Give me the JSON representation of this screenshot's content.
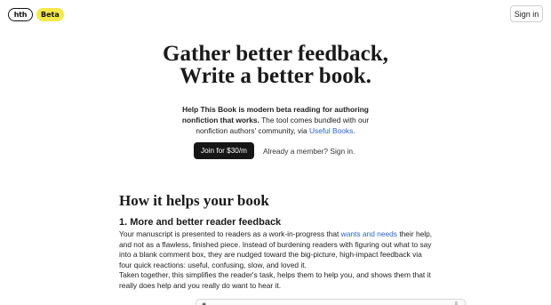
{
  "header": {
    "logo_text": "hth",
    "beta_label": "Beta",
    "signin_label": "Sign in"
  },
  "hero": {
    "title_line1": "Gather better feedback,",
    "title_line2": "Write a better book.",
    "intro_bold": "Help This Book is modern beta reading for authoring nonfiction that works.",
    "intro_rest": " The tool comes bundled with our nonfiction authors' community, via ",
    "intro_link": "Useful Books",
    "intro_end": ".",
    "join_label": "Join for $30/m",
    "member_label": "Already a member? Sign in."
  },
  "section": {
    "title": "How it helps your book",
    "subtitle": "1. More and better reader feedback",
    "p1_a": "Your manuscript is presented to readers as a work-in-progress that ",
    "p1_link": "wants and needs",
    "p1_b": " their help, and not as a flawless, finished piece. Instead of burdening readers with figuring out what to say into a blank comment box, they are nudged toward the big-picture, high-impact feedback via four quick reactions: useful, confusing, slow, and loved it.",
    "p2": "Taken together, this simplifies the reader's task, helps them to help you, and shows them that it really does help and you really do want to hear it."
  }
}
